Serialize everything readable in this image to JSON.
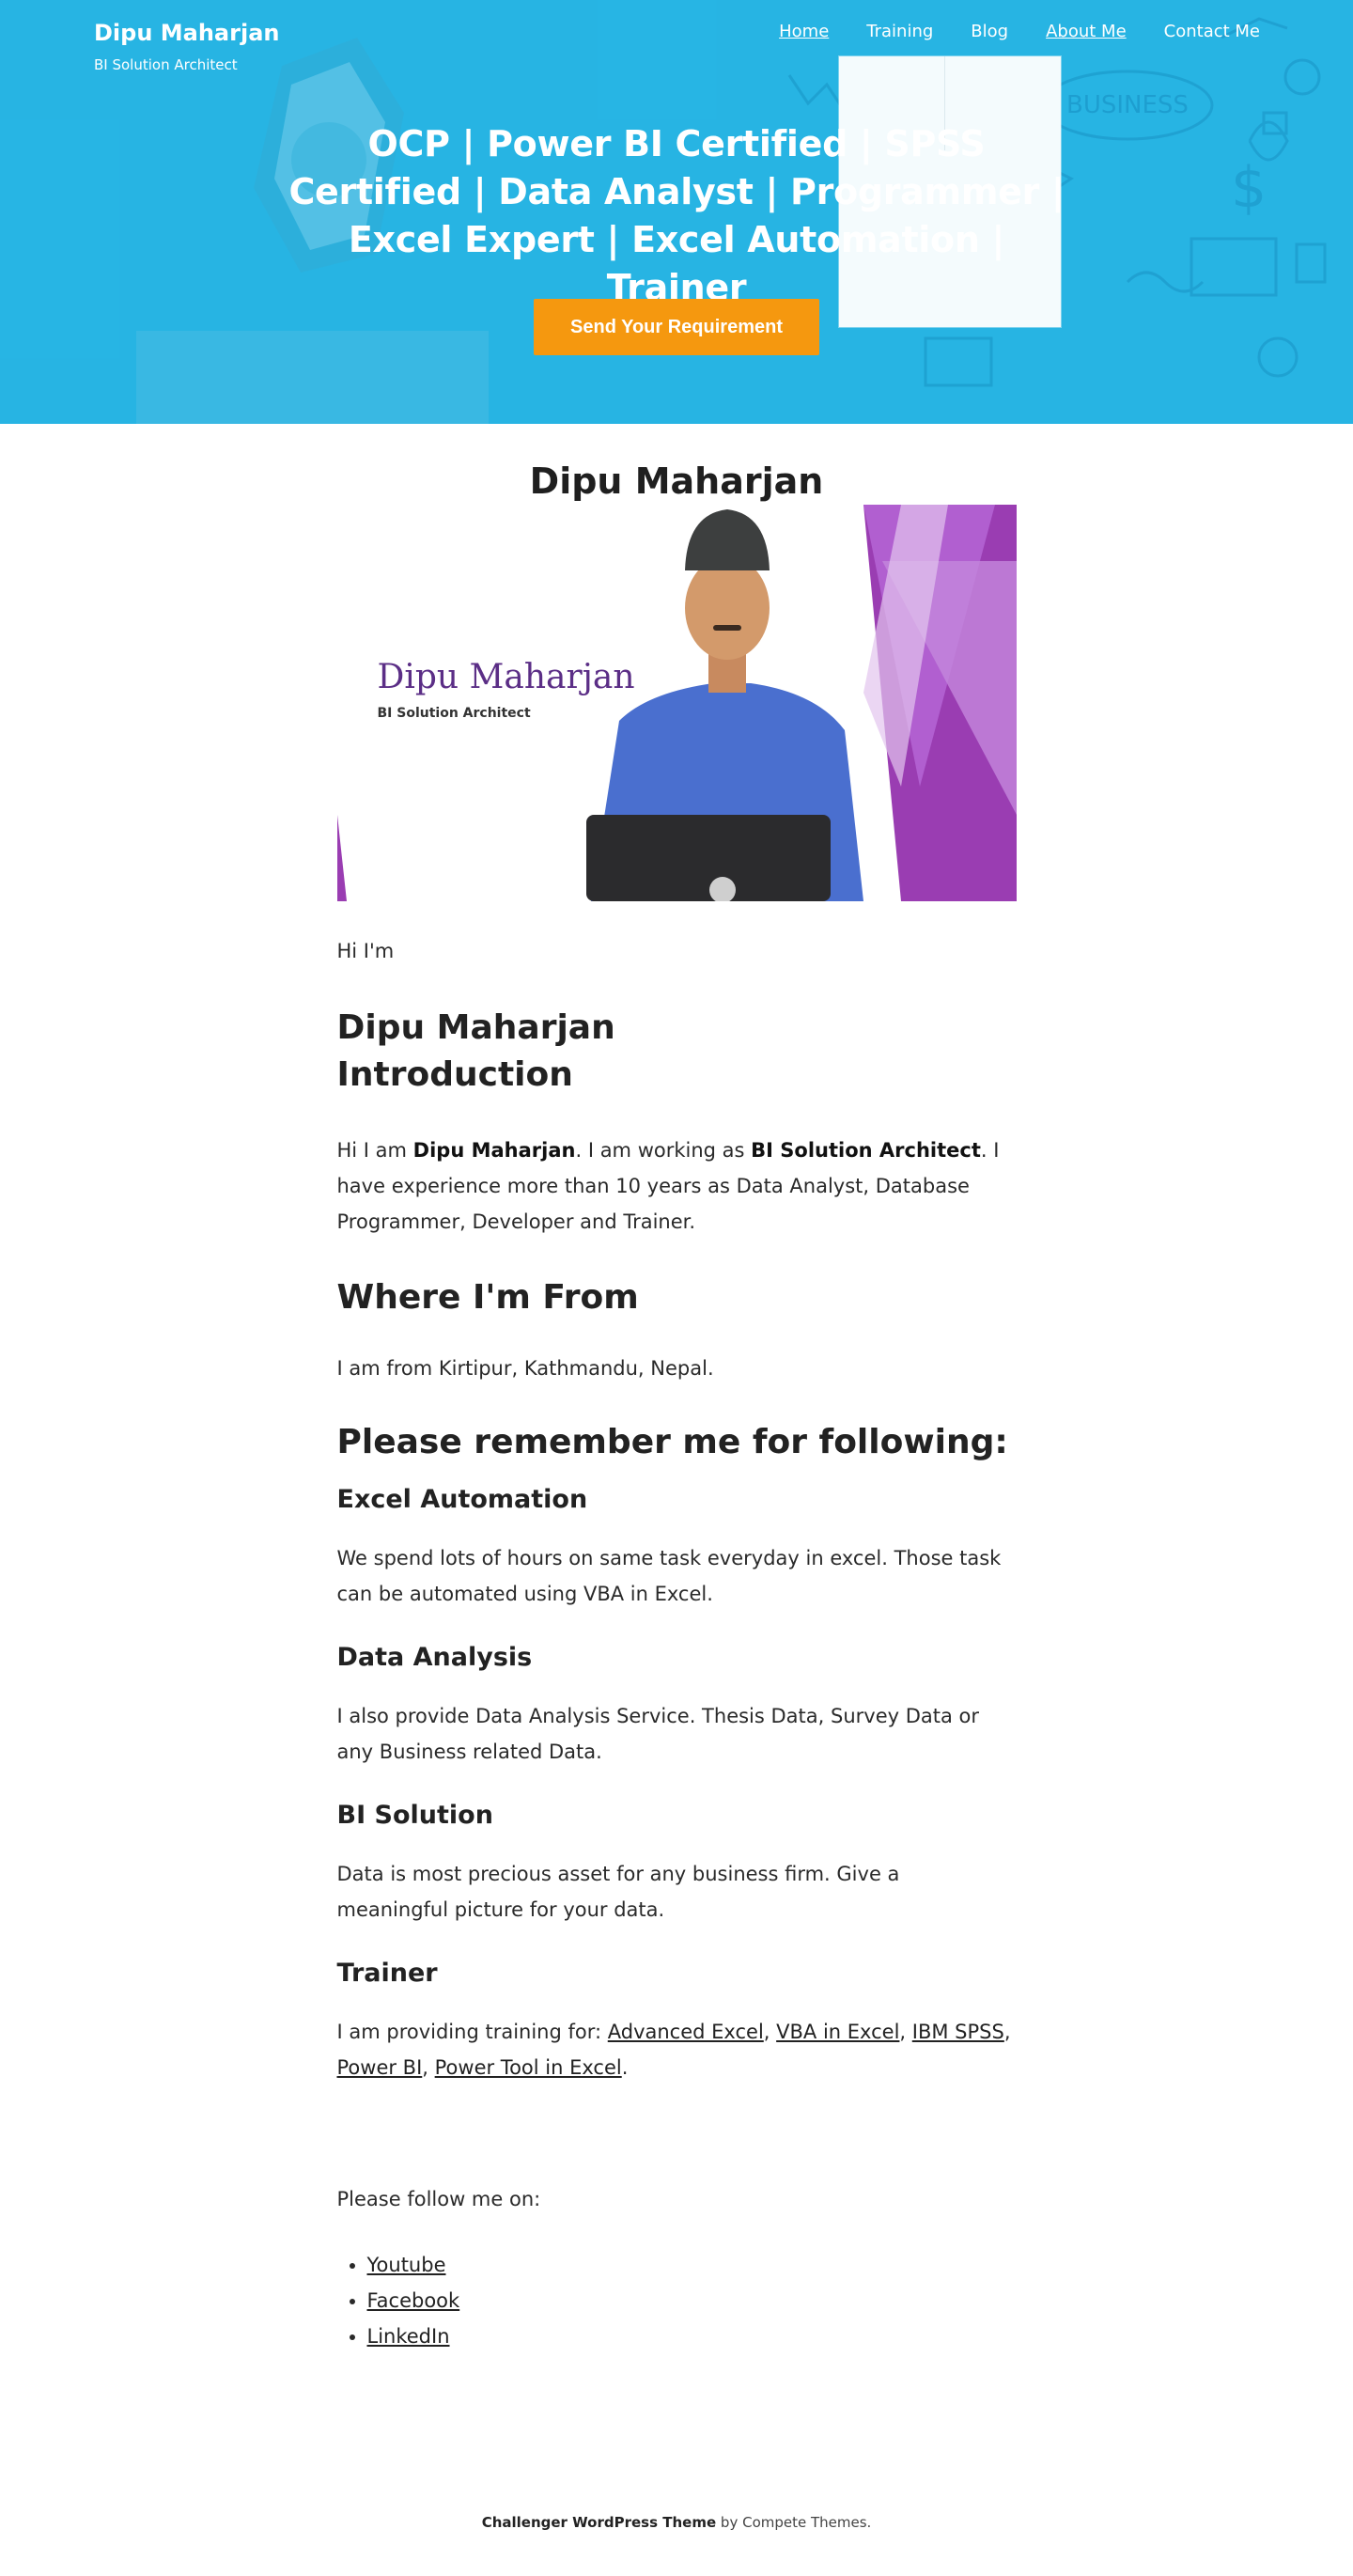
{
  "header": {
    "site_title": "Dipu Maharjan",
    "tagline": "BI Solution Architect",
    "nav": [
      {
        "label": "Home",
        "current": true
      },
      {
        "label": "Training",
        "current": false
      },
      {
        "label": "Blog",
        "current": false
      },
      {
        "label": "About Me",
        "current": true
      },
      {
        "label": "Contact Me",
        "current": false
      }
    ]
  },
  "hero": {
    "heading": "OCP | Power BI Certified | SPSS Certified | Data Analyst | Programmer | Excel Expert | Excel Automation | Trainer",
    "cta_label": "Send Your Requirement",
    "background_color": "#29b4e4",
    "cta_color": "#f5980f"
  },
  "page": {
    "title": "Dipu Maharjan",
    "profile_image": {
      "name_text": "Dipu Maharjan",
      "role_text": "BI Solution Architect",
      "accent_color": "#9a3db2"
    },
    "hi_line": "Hi I'm",
    "intro_heading_line1": "Dipu Maharjan",
    "intro_heading_line2": "Introduction",
    "intro": {
      "p1": "Hi I am ",
      "name": "Dipu Maharjan",
      "p2": ". I am working as ",
      "role": "BI Solution Architect",
      "p3": ". I have experience more than 10 years as Data Analyst, Database Programmer, Developer and Trainer."
    },
    "from_heading": "Where I'm From",
    "from_text": "I am from Kirtipur, Kathmandu, Nepal.",
    "remember_heading": "Please remember me for following:",
    "skills": [
      {
        "title": "Excel Automation",
        "text": "We spend lots of hours on same task everyday in excel. Those task can be automated using VBA in Excel."
      },
      {
        "title": "Data Analysis",
        "text": "I also provide Data Analysis Service. Thesis Data, Survey Data or any Business related Data."
      },
      {
        "title": "BI Solution",
        "text": "Data is most precious asset for any business firm. Give a meaningful picture for your data."
      }
    ],
    "trainer": {
      "title": "Trainer",
      "prefix": "I am providing training for: ",
      "links": [
        "Advanced Excel",
        "VBA in Excel",
        "IBM SPSS",
        "Power BI",
        "Power Tool in Excel"
      ],
      "sep": ", ",
      "end": "."
    },
    "follow_text": "Please follow me on:",
    "follow_links": [
      "Youtube",
      "Facebook",
      "LinkedIn"
    ]
  },
  "footer": {
    "theme_link": "Challenger WordPress Theme",
    "by_text": " by Compete Themes."
  }
}
